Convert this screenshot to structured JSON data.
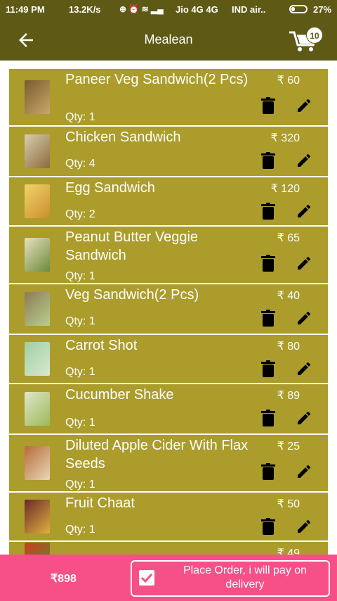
{
  "status_bar": {
    "time": "11:49 PM",
    "speed": "13.2K/s",
    "carrier1": "Jio 4G 4G",
    "carrier2": "IND air..",
    "battery": "27%",
    "battery_level": 0.27
  },
  "header": {
    "title": "Mealean",
    "cart_count": "10",
    "back_icon": "arrow-left-icon",
    "cart_icon": "cart-icon"
  },
  "items": [
    {
      "name": "Paneer Veg Sandwich(2 Pcs)",
      "qty": "Qty: 1",
      "price": "₹ 60"
    },
    {
      "name": "Chicken Sandwich",
      "qty": "Qty: 4",
      "price": "₹ 320"
    },
    {
      "name": "Egg Sandwich",
      "qty": "Qty: 2",
      "price": "₹ 120"
    },
    {
      "name": "Peanut Butter Veggie Sandwich",
      "qty": "Qty: 1",
      "price": "₹ 65"
    },
    {
      "name": "Veg Sandwich(2 Pcs)",
      "qty": "Qty: 1",
      "price": "₹ 40"
    },
    {
      "name": "Carrot Shot",
      "qty": "Qty: 1",
      "price": "₹ 80"
    },
    {
      "name": "Cucumber Shake",
      "qty": "Qty: 1",
      "price": "₹ 89"
    },
    {
      "name": "Diluted Apple Cider With Flax Seeds",
      "qty": "Qty: 1",
      "price": "₹ 25"
    },
    {
      "name": "Fruit Chaat",
      "qty": "Qty: 1",
      "price": "₹ 50"
    },
    {
      "name": "",
      "qty": "",
      "price": "₹ 49"
    }
  ],
  "footer": {
    "total": "₹898",
    "place_order_label": "Place Order, i will pay on delivery"
  },
  "colors": {
    "app_bar": "#5e5a16",
    "item_bg": "#ab9c2c",
    "footer_bg": "#f74f88",
    "accent_text": "#ffffff"
  }
}
